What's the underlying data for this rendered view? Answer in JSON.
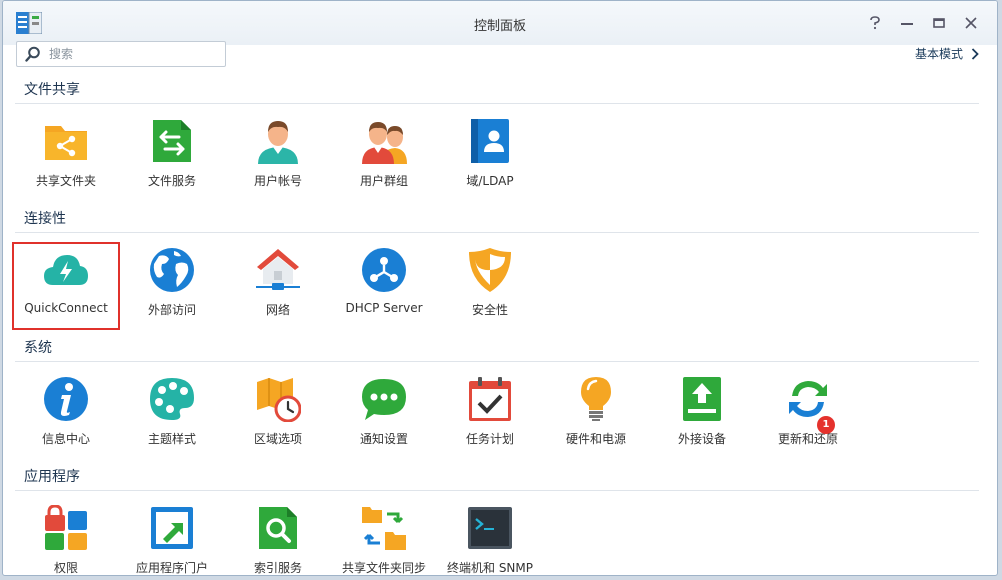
{
  "window": {
    "title": "控制面板"
  },
  "search": {
    "placeholder": "搜索"
  },
  "mode_link": {
    "label": "基本模式"
  },
  "sections": [
    {
      "title": "文件共享",
      "items": [
        {
          "label": "共享文件夹",
          "icon": "shared-folder-icon"
        },
        {
          "label": "文件服务",
          "icon": "file-services-icon"
        },
        {
          "label": "用户帐号",
          "icon": "user-icon"
        },
        {
          "label": "用户群组",
          "icon": "group-icon"
        },
        {
          "label": "域/LDAP",
          "icon": "domain-ldap-icon"
        }
      ]
    },
    {
      "title": "连接性",
      "items": [
        {
          "label": "QuickConnect",
          "icon": "quickconnect-cloud-icon"
        },
        {
          "label": "外部访问",
          "icon": "globe-icon"
        },
        {
          "label": "网络",
          "icon": "network-house-icon"
        },
        {
          "label": "DHCP Server",
          "icon": "dhcp-server-icon"
        },
        {
          "label": "安全性",
          "icon": "security-shield-icon"
        }
      ]
    },
    {
      "title": "系统",
      "items": [
        {
          "label": "信息中心",
          "icon": "info-icon"
        },
        {
          "label": "主题样式",
          "icon": "palette-icon"
        },
        {
          "label": "区域选项",
          "icon": "regional-clock-icon"
        },
        {
          "label": "通知设置",
          "icon": "notification-chat-icon"
        },
        {
          "label": "任务计划",
          "icon": "task-calendar-icon"
        },
        {
          "label": "硬件和电源",
          "icon": "bulb-icon"
        },
        {
          "label": "外接设备",
          "icon": "external-device-icon"
        },
        {
          "label": "更新和还原",
          "icon": "update-restore-icon",
          "badge": "1"
        }
      ]
    },
    {
      "title": "应用程序",
      "items": [
        {
          "label": "权限",
          "icon": "privileges-icon"
        },
        {
          "label": "应用程序门户",
          "icon": "app-portal-icon"
        },
        {
          "label": "索引服务",
          "icon": "index-search-icon"
        },
        {
          "label": "共享文件夹同步",
          "icon": "folder-sync-icon"
        },
        {
          "label": "终端机和 SNMP",
          "icon": "terminal-icon"
        }
      ]
    }
  ],
  "colors": {
    "selected_outline": "#e0312b",
    "accent_blue": "#1a7fd4",
    "badge_red": "#e5322d"
  }
}
